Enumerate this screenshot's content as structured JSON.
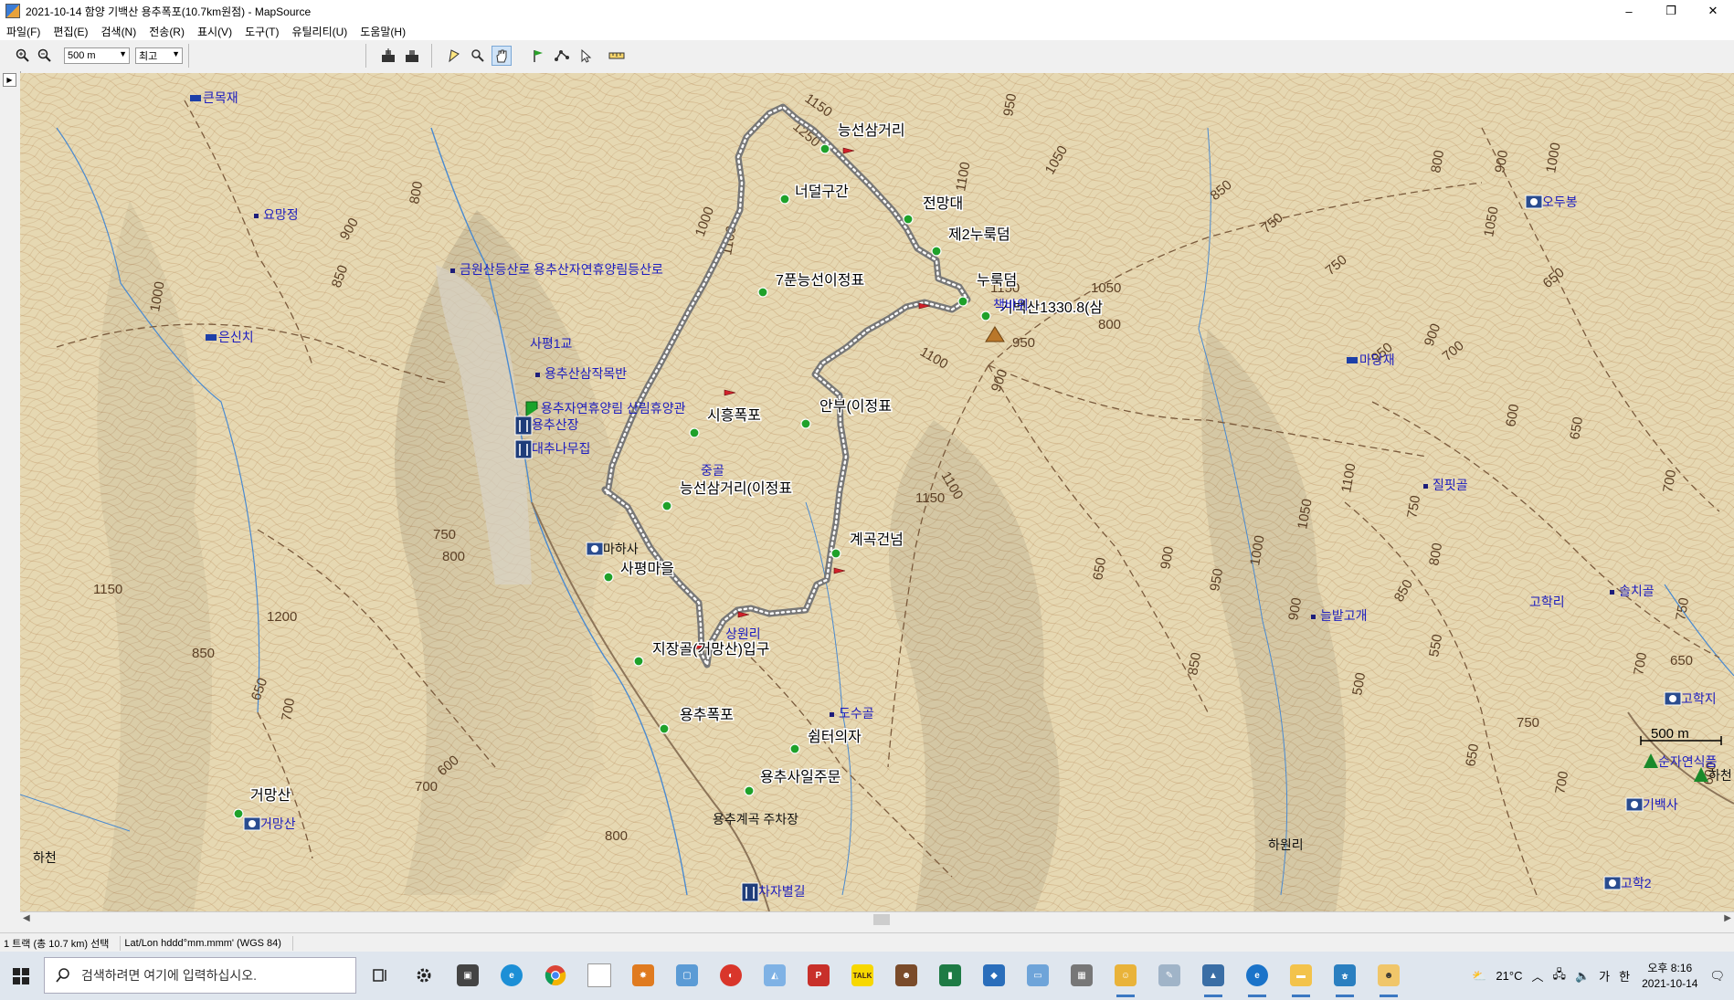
{
  "window": {
    "title": "2021-10-14 함양 기백산 용추폭포(10.7km원점) - MapSource",
    "minimize": "–",
    "maximize": "❐",
    "close": "✕"
  },
  "menu": [
    "파일(F)",
    "편집(E)",
    "검색(N)",
    "전송(R)",
    "표시(V)",
    "도구(T)",
    "유틸리티(U)",
    "도움말(H)"
  ],
  "toolbar": {
    "zoom_scale": "500 m",
    "detail_level": "최고"
  },
  "map": {
    "colors": {
      "background": "#e8dcb8",
      "contour": "#b48a5c",
      "track": "#777777",
      "track_dots": "#ffffff",
      "waypoint": "#1fa12a",
      "poi_text": "#1d1dbf",
      "stream": "#4a8ad0",
      "road_dash": "#7a5a3c"
    },
    "waypoint_labels": [
      "능선삼거리",
      "너덜구간",
      "전망대",
      "제2누룩덤",
      "누룩덤",
      "기백산1330.8(삼",
      "7푼능선이정표",
      "안부(이정표",
      "시흥폭포",
      "능선삼거리(이정표",
      "계곡건넘",
      "사평마을",
      "지장골(거망산)입구",
      "용추폭포",
      "쉼터의자",
      "용추사일주문",
      "거망산"
    ],
    "poi_labels": [
      "큰목재",
      "요망정",
      "은신치",
      "금원산등산로 용추산자연휴양림등산로",
      "사평1교",
      "용추산삼작목반",
      "용추자연휴양림 산림휴양관",
      "용추산장",
      "대추나무집",
      "중골",
      "마하사",
      "상원리",
      "도수골",
      "용추계곡 주차장",
      "거망산",
      "차자별길",
      "책바위",
      "마당재",
      "질핏골",
      "늘밭고개",
      "고학리",
      "솔치골",
      "고학지",
      "순자연식품",
      "하천",
      "기백사",
      "고학2",
      "오두봉",
      "하원리",
      "하천"
    ],
    "contour_labels": [
      "1150",
      "1250",
      "950",
      "1050",
      "1100",
      "1000",
      "1100",
      "1150",
      "1050",
      "1100",
      "900",
      "800",
      "850",
      "750",
      "800",
      "900",
      "1000",
      "1050",
      "900",
      "950",
      "800",
      "850",
      "900",
      "950",
      "1000",
      "1100",
      "1150",
      "750",
      "700",
      "650",
      "600",
      "650",
      "700",
      "750",
      "800",
      "850",
      "900",
      "500",
      "550",
      "650",
      "700",
      "750",
      "600",
      "650",
      "700",
      "750",
      "800",
      "850",
      "900",
      "950",
      "1000",
      "1050",
      "1100",
      "1150",
      "1200",
      "850",
      "700",
      "750",
      "800",
      "650",
      "600",
      "700",
      "650"
    ],
    "scale_bar": "500 m"
  },
  "status": {
    "selection": "1 트랙 (총 10.7 km) 선택",
    "coord_format": "Lat/Lon hddd°mm.mmm' (WGS 84)"
  },
  "taskbar": {
    "search_placeholder": "검색하려면 여기에 입력하십시오.",
    "weather": "21°C",
    "ime": "가",
    "ime2": "한",
    "time": "오후 8:16",
    "date": "2021-10-14"
  }
}
